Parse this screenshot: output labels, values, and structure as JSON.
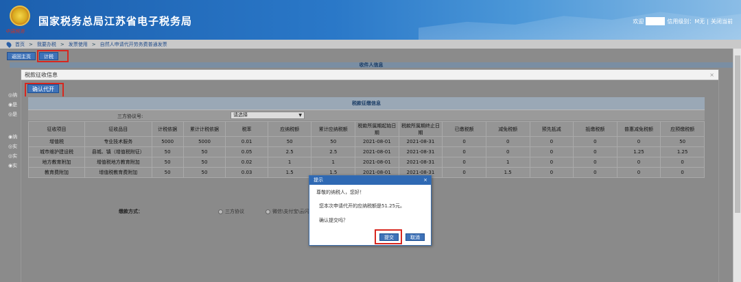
{
  "header": {
    "title": "国家税务总局江苏省电子税务局",
    "emblem_caption": "中国税务",
    "welcome": "欢迎",
    "credit_level": "信用级别：M无",
    "close_page": "关闭当前"
  },
  "breadcrumb": [
    "首页",
    "我要办税",
    "发票使用",
    "自然人申请代开劳务费普通发票"
  ],
  "breadcrumb_sep": ">",
  "back": {
    "return_button": "返回主页",
    "calc_button": "计税",
    "payee_info": "收件人信息",
    "side_stubs": [
      "◎纳",
      "◉是",
      "◎是",
      "◉纳",
      "◎实",
      "◎实",
      "◉实"
    ]
  },
  "modal": {
    "title": "税款征收信息",
    "close": "×",
    "confirm_button": "确认代开",
    "section_title": "税款征缴信息",
    "protocol_label": "三方协议号:",
    "protocol_select": "请选择",
    "payment_label": "缴款方式：",
    "payment_options": [
      "三方协议",
      "微信\\支付宝\\云闪付"
    ],
    "table": {
      "headers": [
        "征收项目",
        "征收品目",
        "计税依据",
        "累计计税依据",
        "税率",
        "应纳税额",
        "累计应纳税额",
        "税款所属期起始日期",
        "税款所属期终止日期",
        "已缴税额",
        "减免税额",
        "预先抵减",
        "抵缴税额",
        "普惠减免税额",
        "应预缴税额"
      ],
      "rows": [
        [
          "增值税",
          "专业技术服务",
          "5000",
          "5000",
          "0.01",
          "50",
          "50",
          "2021-08-01",
          "2021-08-31",
          "0",
          "0",
          "0",
          "0",
          "0",
          "50"
        ],
        [
          "城市维护建设税",
          "县城、镇（增值税附征）",
          "50",
          "50",
          "0.05",
          "2.5",
          "2.5",
          "2021-08-01",
          "2021-08-31",
          "0",
          "0",
          "0",
          "0",
          "1.25",
          "1.25"
        ],
        [
          "地方教育附加",
          "增值税地方教育附加",
          "50",
          "50",
          "0.02",
          "1",
          "1",
          "2021-08-01",
          "2021-08-31",
          "0",
          "1",
          "0",
          "0",
          "0",
          "0"
        ],
        [
          "教育费附加",
          "增值税教育费附加",
          "50",
          "50",
          "0.03",
          "1.5",
          "1.5",
          "2021-08-01",
          "2021-08-31",
          "0",
          "1.5",
          "0",
          "0",
          "0",
          "0"
        ]
      ]
    }
  },
  "dialog": {
    "title": "提示",
    "close": "×",
    "greeting": "尊敬的纳税人，您好！",
    "message": "您本次申请代开的应纳税额是51.25元。",
    "question": "确认提交吗？",
    "submit": "提交",
    "cancel": "取消"
  },
  "colors": {
    "brand": "#1c5fae",
    "button": "#3e72b8",
    "highlight": "#d7261e"
  }
}
